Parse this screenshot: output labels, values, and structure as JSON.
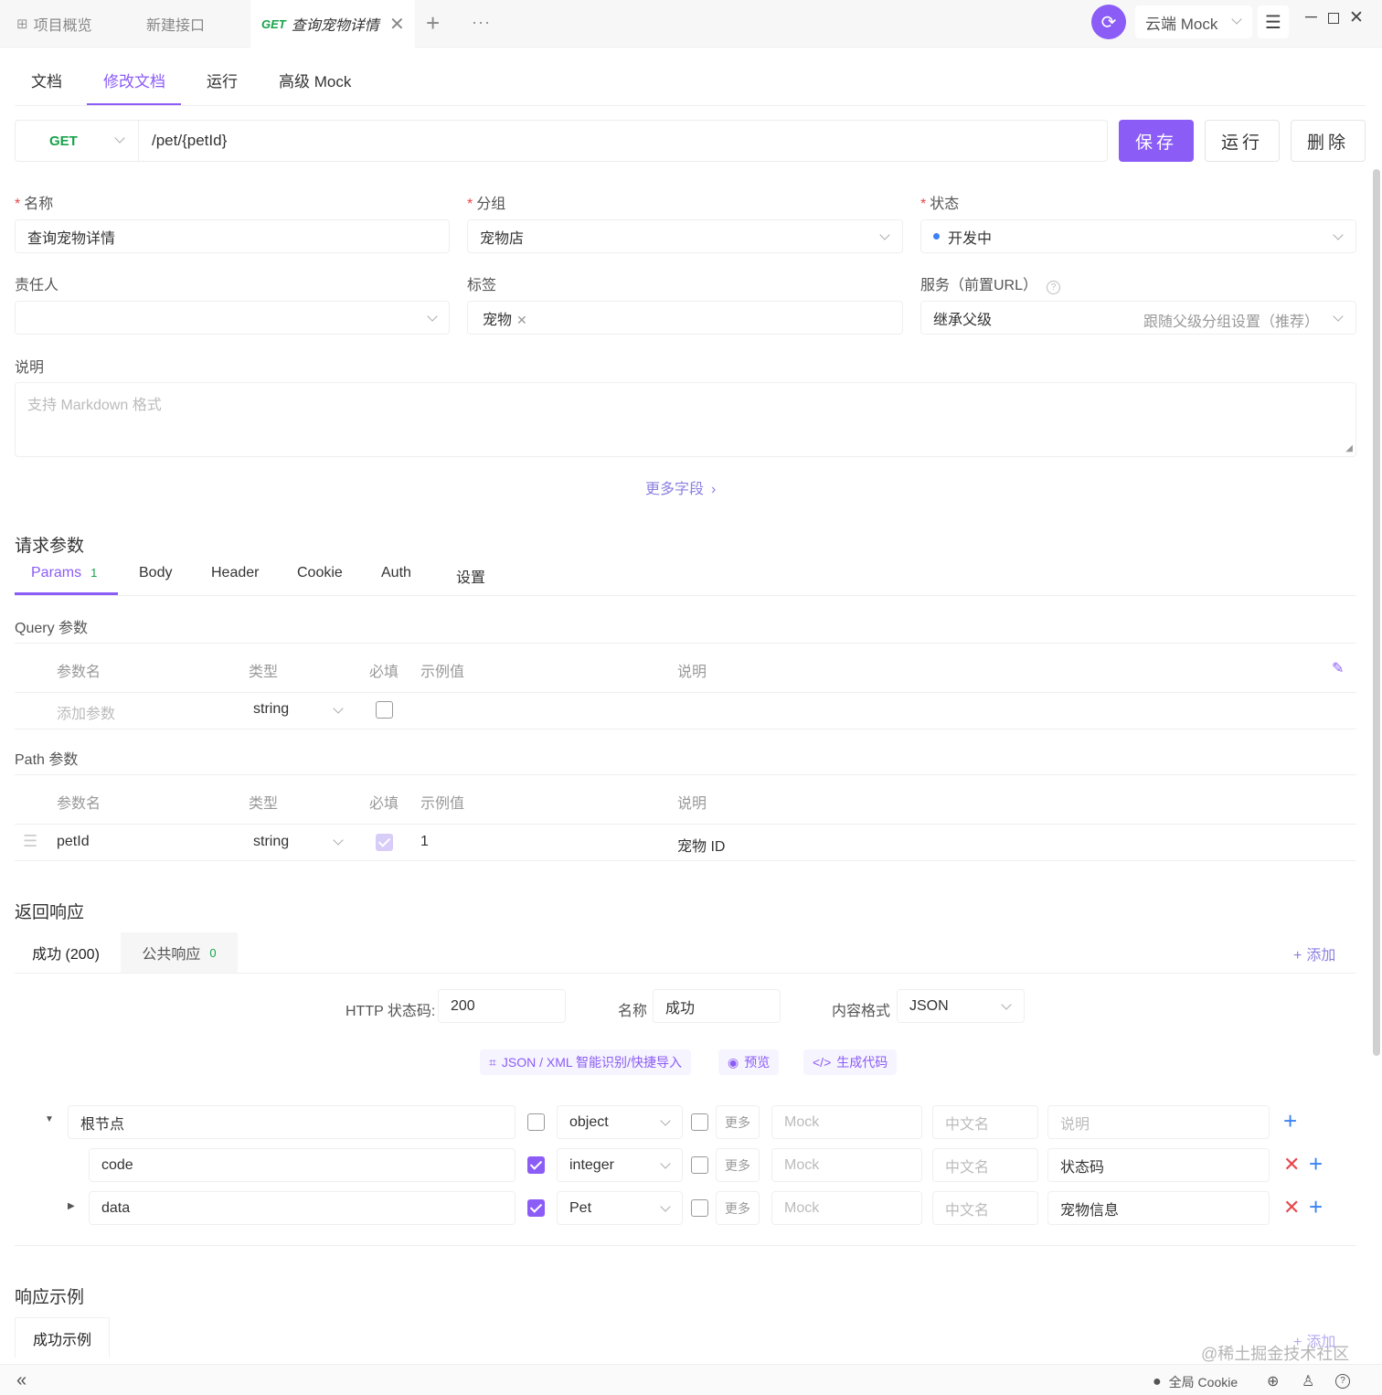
{
  "top_tabs": [
    {
      "label": "项目概览"
    },
    {
      "label": "新建接口"
    },
    {
      "method": "GET",
      "label": "查询宠物详情"
    }
  ],
  "env": {
    "selected": "云端 Mock"
  },
  "sub_tabs": [
    "文档",
    "修改文档",
    "运行",
    "高级 Mock"
  ],
  "request": {
    "method": "GET",
    "path": "/pet/{petId}",
    "save": "保存",
    "run": "运行",
    "delete": "删除"
  },
  "form": {
    "name_label": "名称",
    "name_value": "查询宠物详情",
    "group_label": "分组",
    "group_value": "宠物店",
    "status_label": "状态",
    "status_value": "开发中",
    "owner_label": "责任人",
    "tags_label": "标签",
    "tag_value": "宠物",
    "service_label": "服务（前置URL）",
    "service_value": "继承父级",
    "service_hint": "跟随父级分组设置（推荐）",
    "desc_label": "说明",
    "desc_placeholder": "支持 Markdown 格式",
    "more_fields": "更多字段"
  },
  "params": {
    "title": "请求参数",
    "tabs": [
      "Params",
      "Body",
      "Header",
      "Cookie",
      "Auth",
      "设置"
    ],
    "params_count": "1",
    "columns": {
      "name": "参数名",
      "type": "类型",
      "required": "必填",
      "example": "示例值",
      "desc": "说明"
    },
    "query_title": "Query 参数",
    "query_add_placeholder": "添加参数",
    "query_type": "string",
    "path_title": "Path 参数",
    "path_row": {
      "name": "petId",
      "type": "string",
      "example": "1",
      "desc": "宠物 ID"
    }
  },
  "response": {
    "title": "返回响应",
    "tabs": [
      {
        "label": "成功 (200)"
      },
      {
        "label": "公共响应",
        "count": "0"
      }
    ],
    "add": "添加",
    "http_status_label": "HTTP 状态码:",
    "http_status": "200",
    "name_label": "名称",
    "name_value": "成功",
    "format_label": "内容格式",
    "format_value": "JSON",
    "tools": [
      "JSON / XML 智能识别/快捷导入",
      "预览",
      "生成代码"
    ],
    "schema_rows": [
      {
        "name": "根节点",
        "type": "object",
        "more": "更多",
        "mock": "Mock",
        "cn": "中文名",
        "desc": "说明"
      },
      {
        "name": "code",
        "type": "integer",
        "more": "更多",
        "mock": "Mock",
        "cn": "中文名",
        "desc": "状态码"
      },
      {
        "name": "data",
        "type": "Pet",
        "more": "更多",
        "mock": "Mock",
        "cn": "中文名",
        "desc": "宠物信息"
      }
    ]
  },
  "examples": {
    "title": "响应示例",
    "tab": "成功示例",
    "add": "添加"
  },
  "watermark": "@稀土掘金技术社区",
  "statusbar": {
    "cookie": "全局 Cookie"
  },
  "colors": {
    "accent": "#8B5CF6",
    "get": "#16a34a",
    "danger": "#e5484d",
    "add": "#3b82f6"
  }
}
